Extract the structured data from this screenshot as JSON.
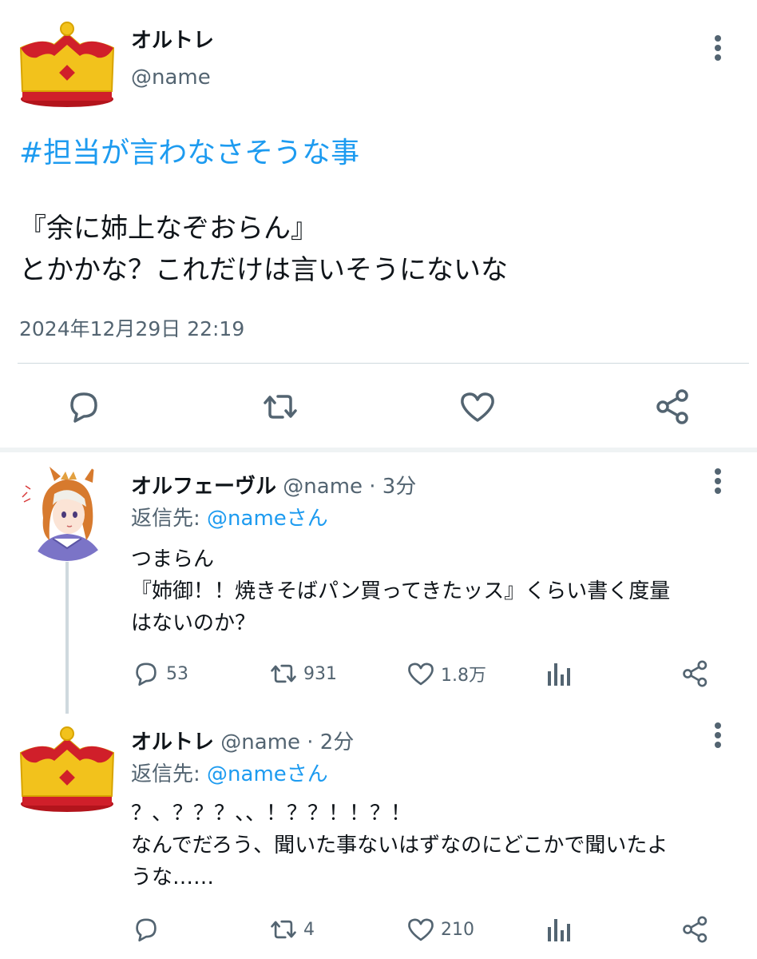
{
  "main_tweet": {
    "name": "オルトレ",
    "handle": "@name",
    "hashtag": "#担当が言わなさそうな事",
    "text": "『余に姉上なぞおらん』\nとかかな？これだけは言いそうにないな",
    "timestamp": "2024年12月29日 22:19",
    "actions": [
      "reply-icon",
      "retweet-icon",
      "like-icon",
      "share-icon"
    ]
  },
  "replies": [
    {
      "name": "オルフェーヴル",
      "meta": "@name · 3分",
      "replying_to_label": "返信先: ",
      "replying_to": "@nameさん",
      "text": "つまらん\n『姉御！！焼きそばパン買ってきたッス』くらい書く度量\nはないのか？",
      "stats": {
        "replies": "53",
        "retweets": "931",
        "likes": "1.8万"
      }
    },
    {
      "name": "オルトレ",
      "meta": "@name · 2分",
      "replying_to_label": "返信先: ",
      "replying_to": "@nameさん",
      "text": "？、？？？、、！？？！！？！\nなんでだろう、聞いた事ないはずなのにどこかで聞いたよ\nうな……",
      "stats": {
        "replies": "",
        "retweets": "4",
        "likes": "210"
      }
    }
  ],
  "colors": {
    "link": "#1d9bf0",
    "secondary": "#536471",
    "divider": "#cfd9de",
    "crown_gold": "#f2c21c",
    "crown_red": "#d01f2a"
  }
}
